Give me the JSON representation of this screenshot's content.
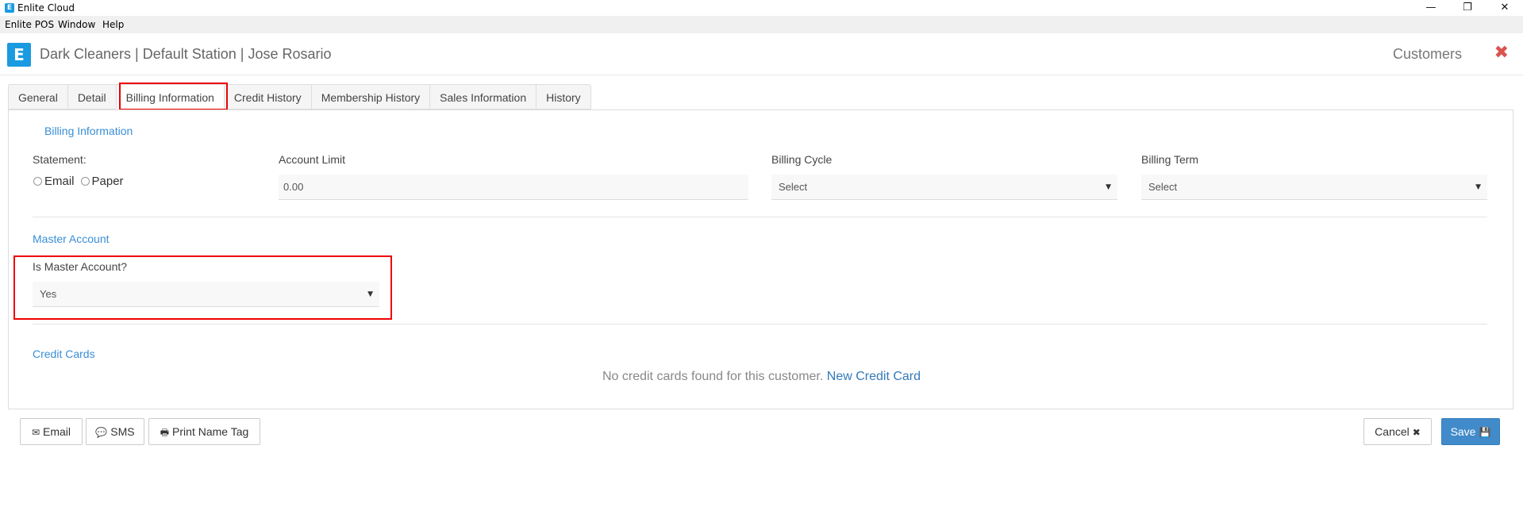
{
  "window": {
    "title": "Enlite Cloud",
    "app_icon_letter": "E",
    "minimize": "—",
    "restore": "❐",
    "close": "✕"
  },
  "menu": [
    "Enlite POS",
    "Window",
    "Help"
  ],
  "header": {
    "logo_letter": "E",
    "title": "Dark Cleaners | Default Station | Jose Rosario",
    "module": "Customers",
    "close_glyph": "✖"
  },
  "tabs": [
    {
      "label": "General"
    },
    {
      "label": "Detail"
    },
    {
      "label": "Billing Information",
      "active": true
    },
    {
      "label": "Credit History"
    },
    {
      "label": "Membership History"
    },
    {
      "label": "Sales Information"
    },
    {
      "label": "History"
    }
  ],
  "billing": {
    "section_title": "Billing Information",
    "statement_label": "Statement:",
    "statement_options": [
      "Email",
      "Paper"
    ],
    "account_limit_label": "Account Limit",
    "account_limit_value": "0.00",
    "billing_cycle_label": "Billing Cycle",
    "billing_cycle_value": "Select",
    "billing_term_label": "Billing Term",
    "billing_term_value": "Select"
  },
  "master": {
    "section_title": "Master Account",
    "is_master_label": "Is Master Account?",
    "is_master_value": "Yes"
  },
  "credit_cards": {
    "section_title": "Credit Cards",
    "empty_message": "No credit cards found for this customer.",
    "new_link": "New Credit Card"
  },
  "footer": {
    "email_label": "Email",
    "sms_label": "SMS",
    "print_label": "Print Name Tag",
    "cancel_label": "Cancel",
    "save_label": "Save"
  },
  "icons": {
    "caret": "▼",
    "email": "✉",
    "sms": "💬",
    "print": "🖶",
    "cancel": "✖",
    "save": "💾"
  },
  "colors": {
    "brand": "#1a9ae0",
    "section_title": "#3a8ed5",
    "primary_button": "#428bca",
    "highlight": "#ee0000",
    "close": "#d9534f"
  }
}
